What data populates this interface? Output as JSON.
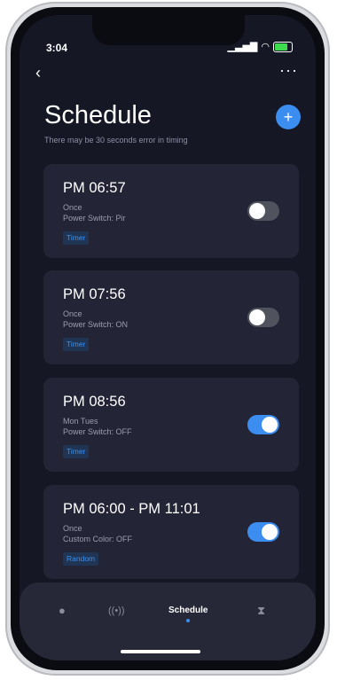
{
  "status_bar": {
    "time": "3:04",
    "signal": "▁▃▅▇"
  },
  "header": {
    "title": "Schedule",
    "subtitle": "There may be 30 seconds error in timing",
    "back_icon": "‹",
    "more_icon": "···",
    "add_icon": "+"
  },
  "schedules": [
    {
      "time": "PM 06:57",
      "repeat": "Once",
      "action": "Power Switch: Pir",
      "tag": "Timer",
      "enabled": false
    },
    {
      "time": "PM 07:56",
      "repeat": "Once",
      "action": "Power Switch: ON",
      "tag": "Timer",
      "enabled": false
    },
    {
      "time": "PM 08:56",
      "repeat": "Mon Tues",
      "action": "Power Switch: OFF",
      "tag": "Timer",
      "enabled": true
    },
    {
      "time": "PM 06:00 - PM 11:01",
      "repeat": "Once",
      "action": "Custom Color: OFF",
      "tag": "Random",
      "enabled": true
    }
  ],
  "bottom_nav": {
    "items": [
      {
        "icon": "lightbulb-icon",
        "glyph": "●"
      },
      {
        "icon": "broadcast-icon",
        "glyph": "((•))"
      },
      {
        "label": "Schedule",
        "active": true
      },
      {
        "icon": "hourglass-icon",
        "glyph": "⧗"
      }
    ]
  },
  "colors": {
    "accent": "#3b8df0",
    "background": "#151725",
    "card": "#232536"
  }
}
